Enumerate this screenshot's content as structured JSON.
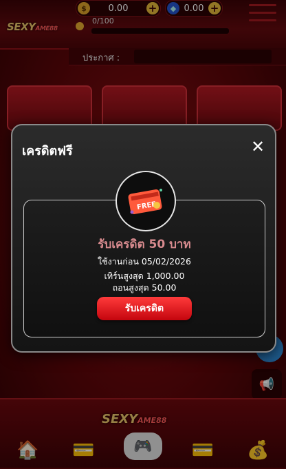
{
  "header": {
    "logo_text": "SEXY",
    "logo_suffix": "AME88",
    "balance": "0.00",
    "gems": "0.00",
    "level_progress": "0/100",
    "level_progress_fraction": 0.0
  },
  "announcement": {
    "label": "ประกาศ :"
  },
  "modal": {
    "title": "เครดิตฟรี",
    "badge_text": "FREE",
    "offer_title": "รับเครดิต 50 บาท",
    "valid_before": "ใช้งานก่อน 05/02/2026",
    "max_turnover": "เทิร์นสูงสุด 1,000.00",
    "max_withdraw": "ถอนสูงสุด 50.00",
    "claim_label": "รับเครดิต"
  },
  "bottom": {
    "logo_text": "SEXY",
    "logo_suffix": "AME88"
  },
  "colors": {
    "brand_red": "#c4050e",
    "offer_title": "#d78a8e",
    "gold": "#e8c46b"
  }
}
